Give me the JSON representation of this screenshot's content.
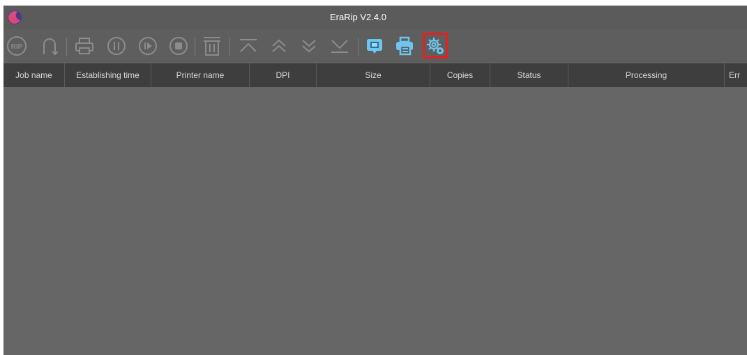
{
  "window": {
    "title": "EraRip V2.4.0",
    "logo_icon": "erarip-logo-icon"
  },
  "toolbar": {
    "buttons": [
      {
        "name": "rip-button",
        "icon": "rip-icon",
        "label": "RIP",
        "enabled": false
      },
      {
        "name": "undo-button",
        "icon": "undo-arc-icon",
        "enabled": false
      },
      {
        "name": "print-button",
        "icon": "printer-icon",
        "enabled": false
      },
      {
        "name": "pause-button",
        "icon": "pause-circle-icon",
        "enabled": false
      },
      {
        "name": "resume-button",
        "icon": "play-circle-icon",
        "enabled": false
      },
      {
        "name": "stop-button",
        "icon": "stop-circle-icon",
        "enabled": false
      },
      {
        "name": "delete-button",
        "icon": "trash-icon",
        "enabled": false
      },
      {
        "name": "move-top-button",
        "icon": "move-top-icon",
        "enabled": false
      },
      {
        "name": "move-up-button",
        "icon": "double-chevron-up-icon",
        "enabled": false
      },
      {
        "name": "move-down-button",
        "icon": "double-chevron-down-icon",
        "enabled": false
      },
      {
        "name": "move-bottom-button",
        "icon": "move-bottom-icon",
        "enabled": false
      },
      {
        "name": "preview-button",
        "icon": "monitor-icon",
        "enabled": true
      },
      {
        "name": "printer-settings-button",
        "icon": "printer-settings-icon",
        "enabled": true
      },
      {
        "name": "settings-button",
        "icon": "gear-settings-icon",
        "enabled": true,
        "highlighted": true
      }
    ],
    "highlight_color": "#e8201c",
    "enabled_icon_color": "#6ec6f0"
  },
  "table": {
    "columns": [
      "Job name",
      "Establishing time",
      "Printer name",
      "DPI",
      "Size",
      "Copies",
      "Status",
      "Processing",
      "Err"
    ],
    "rows": []
  }
}
